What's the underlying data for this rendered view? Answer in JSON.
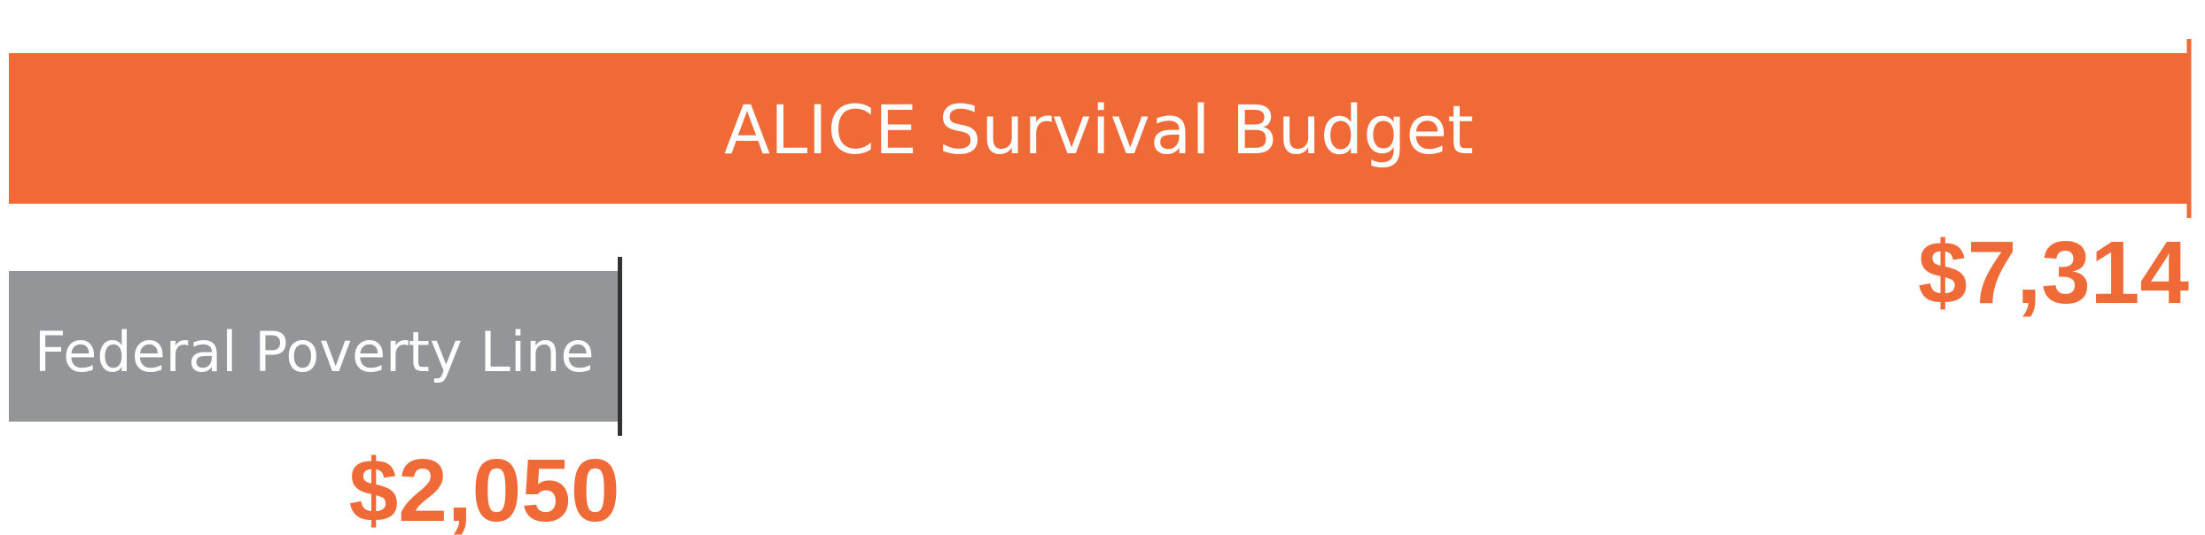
{
  "chart_data": {
    "type": "bar",
    "orientation": "horizontal",
    "categories": [
      "ALICE Survival Budget",
      "Federal Poverty Line"
    ],
    "values": [
      7314,
      2050
    ],
    "value_labels": [
      "$7,314",
      "$2,050"
    ],
    "colors": {
      "ALICE Survival Budget": "#f06a37",
      "Federal Poverty Line": "#939598",
      "value_label": "#f06a37",
      "end_marker": "#333333"
    },
    "title": "",
    "xlabel": "",
    "ylabel": "",
    "xlim": [
      0,
      7314
    ],
    "grid": false,
    "legend": "none"
  }
}
